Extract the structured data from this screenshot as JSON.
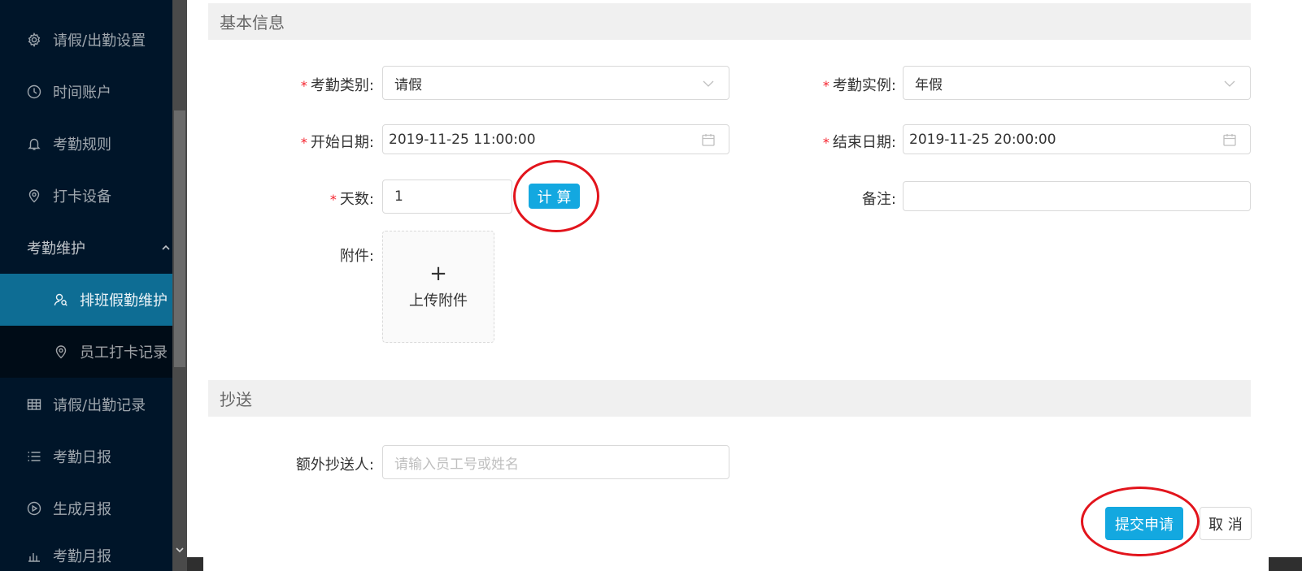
{
  "sidebar": {
    "items": [
      {
        "label": "请假/出勤设置",
        "icon": "gear-icon"
      },
      {
        "label": "时间账户",
        "icon": "clock-icon"
      },
      {
        "label": "考勤规则",
        "icon": "bell-icon"
      },
      {
        "label": "打卡设备",
        "icon": "location-icon"
      }
    ],
    "group": {
      "label": "考勤维护"
    },
    "sub_items": [
      {
        "label": "排班假勤维护",
        "icon": "user-search-icon"
      },
      {
        "label": "员工打卡记录",
        "icon": "location-icon"
      }
    ],
    "bottom_items": [
      {
        "label": "请假/出勤记录",
        "icon": "table-icon"
      },
      {
        "label": "考勤日报",
        "icon": "list-icon"
      },
      {
        "label": "生成月报",
        "icon": "play-circle-icon"
      },
      {
        "label": "考勤月报",
        "icon": "chart-icon"
      }
    ]
  },
  "form": {
    "section_basic": "基本信息",
    "section_cc": "抄送",
    "attendance_type": {
      "label": "考勤类别:",
      "value": "请假"
    },
    "attendance_instance": {
      "label": "考勤实例:",
      "value": "年假"
    },
    "start_date": {
      "label": "开始日期:",
      "value": "2019-11-25 11:00:00"
    },
    "end_date": {
      "label": "结束日期:",
      "value": "2019-11-25 20:00:00"
    },
    "days": {
      "label": "天数:",
      "value": "1"
    },
    "calc_button": "计 算",
    "remark": {
      "label": "备注:",
      "value": ""
    },
    "attachment": {
      "label": "附件:",
      "upload_plus": "+",
      "upload_text": "上传附件"
    },
    "cc_person": {
      "label": "额外抄送人:",
      "placeholder": "请输入员工号或姓名"
    },
    "submit_button": "提交申请",
    "cancel_button": "取 消"
  },
  "colors": {
    "primary": "#13a8e0",
    "sidebar_bg": "#001529",
    "active_item": "#0e6d94",
    "required": "#f5222d",
    "annotation": "#e2141c"
  }
}
